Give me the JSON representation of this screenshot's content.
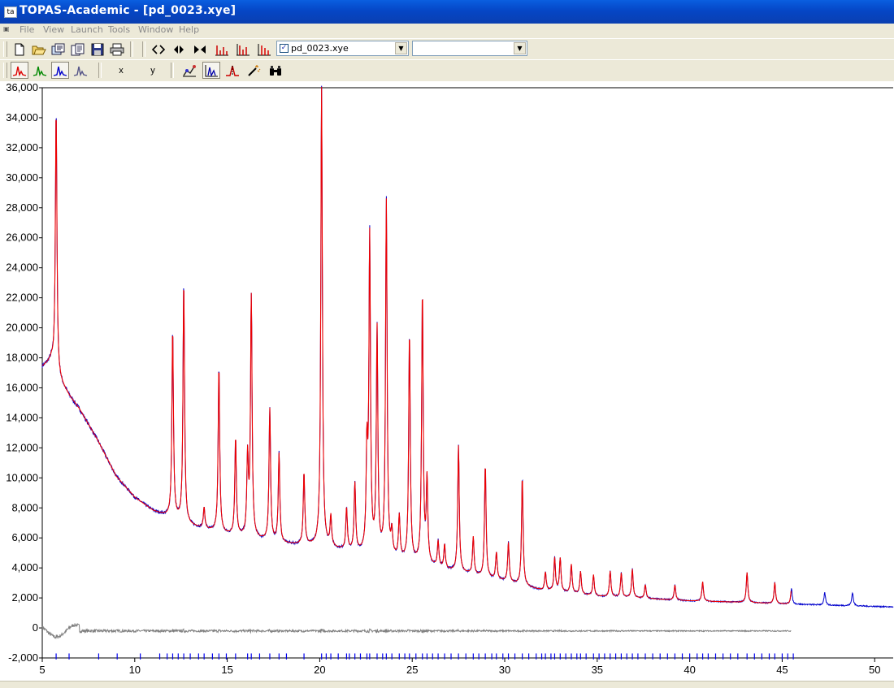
{
  "window": {
    "title": "TOPAS-Academic - [pd_0023.xye]",
    "app_icon": "ta"
  },
  "menu": [
    "File",
    "View",
    "Launch",
    "Tools",
    "Window",
    "Help"
  ],
  "toolbar1": {
    "file_combo": {
      "checked": true,
      "value": "pd_0023.xye"
    },
    "second_combo": {
      "value": ""
    }
  },
  "toolbar2": {
    "x_label": "x",
    "y_label": "y"
  },
  "chart_data": {
    "type": "line",
    "title": "",
    "xlabel": "",
    "ylabel": "",
    "xlim": [
      5,
      51
    ],
    "ylim": [
      -2000,
      36000
    ],
    "grid": false,
    "y_ticks": [
      -2000,
      0,
      2000,
      4000,
      6000,
      8000,
      10000,
      12000,
      14000,
      16000,
      18000,
      20000,
      22000,
      24000,
      26000,
      28000,
      30000,
      32000,
      34000,
      36000
    ],
    "y_tick_labels": [
      "-2,000",
      "0",
      "2,000",
      "4,000",
      "6,000",
      "8,000",
      "10,000",
      "12,000",
      "14,000",
      "16,000",
      "18,000",
      "20,000",
      "22,000",
      "24,000",
      "26,000",
      "28,000",
      "30,000",
      "32,000",
      "34,000",
      "36,000"
    ],
    "x_ticks": [
      5,
      10,
      15,
      20,
      25,
      30,
      35,
      40,
      45,
      50
    ],
    "x_tick_labels": [
      "5",
      "10",
      "15",
      "20",
      "25",
      "30",
      "35",
      "40",
      "45",
      "50"
    ],
    "colors": {
      "observed": "#0000cc",
      "calculated": "#ee0000",
      "difference": "#808080",
      "reflections": "#0000ee"
    },
    "background": [
      [
        5.0,
        17400
      ],
      [
        5.5,
        17800
      ],
      [
        5.9,
        16500
      ],
      [
        6.5,
        15400
      ],
      [
        7.0,
        14600
      ],
      [
        8.0,
        12500
      ],
      [
        9.0,
        10100
      ],
      [
        10.0,
        8700
      ],
      [
        11.0,
        7800
      ],
      [
        12.0,
        7300
      ],
      [
        13.0,
        6800
      ],
      [
        14.0,
        6500
      ],
      [
        15.0,
        6200
      ],
      [
        16.0,
        6000
      ],
      [
        17.0,
        5800
      ],
      [
        18.0,
        5600
      ],
      [
        19.0,
        5500
      ],
      [
        20.0,
        5400
      ],
      [
        21.0,
        5200
      ],
      [
        22.0,
        5000
      ],
      [
        23.0,
        4800
      ],
      [
        24.0,
        4600
      ],
      [
        25.0,
        4300
      ],
      [
        26.0,
        4100
      ],
      [
        27.0,
        3800
      ],
      [
        28.0,
        3600
      ],
      [
        29.0,
        3300
      ],
      [
        30.0,
        3100
      ],
      [
        31.0,
        2800
      ],
      [
        32.0,
        2500
      ],
      [
        33.0,
        2400
      ],
      [
        35.0,
        2100
      ],
      [
        37.0,
        2000
      ],
      [
        40.0,
        1800
      ],
      [
        43.0,
        1700
      ],
      [
        45.0,
        1600
      ],
      [
        48.0,
        1500
      ],
      [
        51.0,
        1400
      ]
    ],
    "peaks": [
      [
        5.75,
        17500,
        0.05
      ],
      [
        12.05,
        12500,
        0.05
      ],
      [
        12.65,
        16000,
        0.05
      ],
      [
        13.75,
        1400,
        0.05
      ],
      [
        14.55,
        11000,
        0.05
      ],
      [
        15.45,
        6500,
        0.05
      ],
      [
        16.1,
        5200,
        0.05
      ],
      [
        16.3,
        16000,
        0.05
      ],
      [
        17.3,
        8800,
        0.05
      ],
      [
        17.8,
        5900,
        0.05
      ],
      [
        19.15,
        4800,
        0.05
      ],
      [
        20.1,
        30600,
        0.05
      ],
      [
        20.6,
        2000,
        0.05
      ],
      [
        21.45,
        2800,
        0.05
      ],
      [
        21.9,
        4500,
        0.05
      ],
      [
        22.55,
        6500,
        0.05
      ],
      [
        22.7,
        20800,
        0.05
      ],
      [
        23.1,
        14900,
        0.05
      ],
      [
        23.6,
        23600,
        0.05
      ],
      [
        23.9,
        1500,
        0.05
      ],
      [
        24.3,
        2800,
        0.05
      ],
      [
        24.85,
        15200,
        0.05
      ],
      [
        25.55,
        18000,
        0.05
      ],
      [
        25.8,
        5500,
        0.05
      ],
      [
        26.4,
        1700,
        0.05
      ],
      [
        26.75,
        1600,
        0.05
      ],
      [
        27.5,
        8400,
        0.05
      ],
      [
        28.3,
        2500,
        0.05
      ],
      [
        28.95,
        7500,
        0.05
      ],
      [
        29.55,
        1800,
        0.05
      ],
      [
        30.2,
        2600,
        0.05
      ],
      [
        30.95,
        7200,
        0.05
      ],
      [
        32.2,
        1200,
        0.05
      ],
      [
        32.7,
        2200,
        0.05
      ],
      [
        33.0,
        2200,
        0.05
      ],
      [
        33.6,
        1900,
        0.05
      ],
      [
        34.1,
        1500,
        0.05
      ],
      [
        34.8,
        1400,
        0.05
      ],
      [
        35.7,
        1700,
        0.05
      ],
      [
        36.3,
        1600,
        0.05
      ],
      [
        36.9,
        1900,
        0.05
      ],
      [
        37.6,
        900,
        0.05
      ],
      [
        39.2,
        1000,
        0.05
      ],
      [
        40.7,
        1300,
        0.05
      ],
      [
        43.1,
        2000,
        0.05
      ],
      [
        44.6,
        1400,
        0.05
      ],
      [
        45.5,
        1000,
        0.05
      ],
      [
        47.3,
        800,
        0.05
      ],
      [
        48.8,
        900,
        0.05
      ]
    ],
    "reflections": [
      5.75,
      6.45,
      8.05,
      9.05,
      10.3,
      11.35,
      11.75,
      12.05,
      12.35,
      12.65,
      13.0,
      13.45,
      13.75,
      14.2,
      14.55,
      14.95,
      15.45,
      16.1,
      16.3,
      16.75,
      17.3,
      17.8,
      18.2,
      19.15,
      20.1,
      20.35,
      20.6,
      21.0,
      21.45,
      21.6,
      21.9,
      22.2,
      22.55,
      22.7,
      23.1,
      23.4,
      23.6,
      23.9,
      24.3,
      24.6,
      24.85,
      25.2,
      25.55,
      25.8,
      26.1,
      26.4,
      26.75,
      27.1,
      27.5,
      27.9,
      28.3,
      28.6,
      28.95,
      29.3,
      29.55,
      29.9,
      30.2,
      30.55,
      30.95,
      31.3,
      31.7,
      32.0,
      32.2,
      32.5,
      32.7,
      33.0,
      33.3,
      33.6,
      33.9,
      34.1,
      34.4,
      34.8,
      35.1,
      35.4,
      35.7,
      36.0,
      36.3,
      36.6,
      36.9,
      37.2,
      37.6,
      38.0,
      38.4,
      38.8,
      39.2,
      39.6,
      40.0,
      40.4,
      40.7,
      41.0,
      41.4,
      41.8,
      42.2,
      42.6,
      43.1,
      43.5,
      43.9,
      44.3,
      44.6,
      45.0,
      45.3,
      45.6
    ]
  }
}
